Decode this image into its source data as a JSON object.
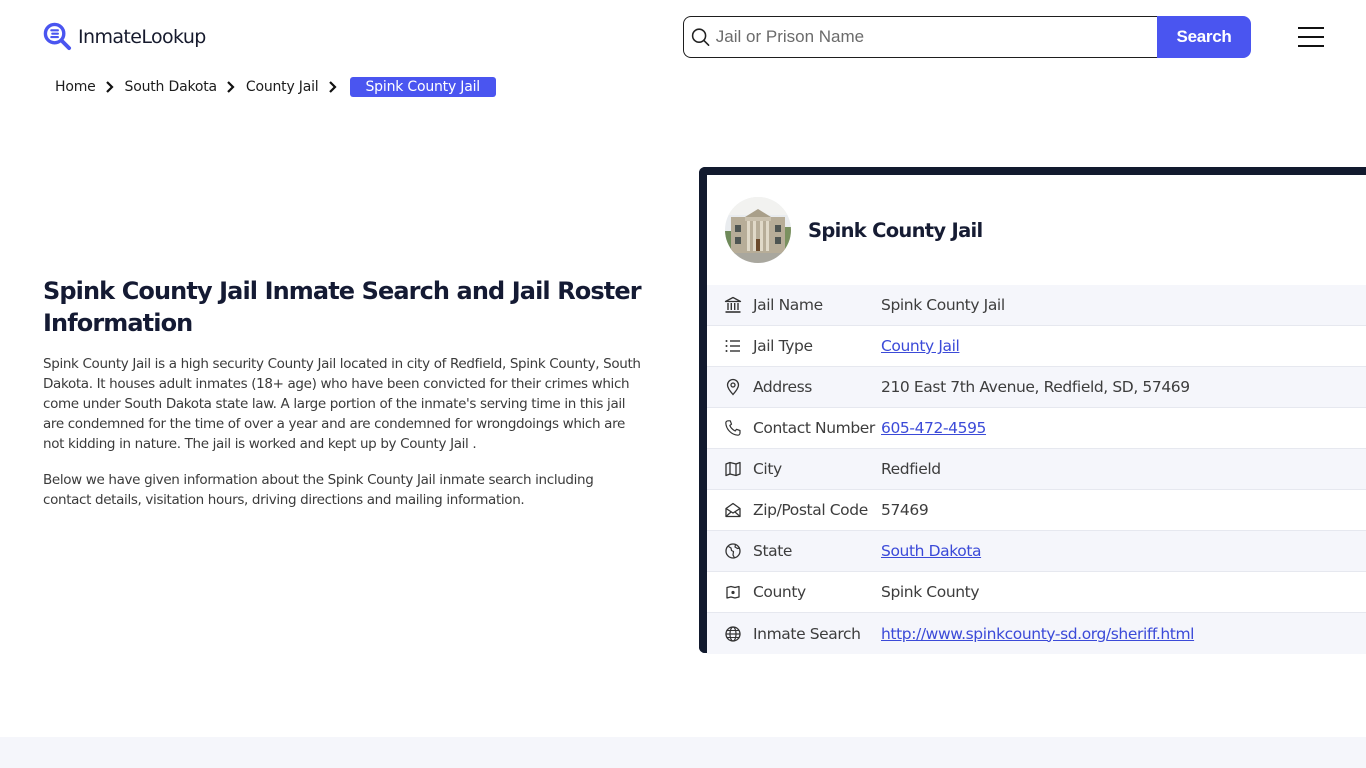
{
  "header": {
    "logo_text": "InmateLookup",
    "search_placeholder": "Jail or Prison Name",
    "search_value": "",
    "search_button": "Search",
    "menu_icon": "hamburger-menu-icon"
  },
  "breadcrumb": {
    "items": [
      "Home",
      "South Dakota",
      "County Jail"
    ],
    "current": "Spink County Jail"
  },
  "main": {
    "title": "Spink County Jail Inmate Search and Jail Roster Information",
    "paragraphs": [
      "Spink County Jail is a high security County Jail located in city of Redfield, Spink County, South Dakota. It houses adult inmates (18+ age) who have been convicted for their crimes which come under South Dakota state law. A large portion of the inmate's serving time in this jail are condemned for the time of over a year and are condemned for wrongdoings which are not kidding in nature. The jail is worked and kept up by County Jail .",
      "Below we have given information about the Spink County Jail inmate search including contact details, visitation hours, driving directions and mailing information."
    ]
  },
  "card": {
    "title": "Spink County Jail",
    "rows": [
      {
        "icon": "bank-building-icon",
        "label": "Jail Name",
        "value": "Spink County Jail",
        "link": false
      },
      {
        "icon": "list-icon",
        "label": "Jail Type",
        "value": "County Jail",
        "link": true
      },
      {
        "icon": "map-pin-icon",
        "label": "Address",
        "value": "210 East 7th Avenue, Redfield, SD, 57469",
        "link": false
      },
      {
        "icon": "phone-icon",
        "label": "Contact Number",
        "value": "605-472-4595",
        "link": true
      },
      {
        "icon": "map-icon",
        "label": "City",
        "value": "Redfield",
        "link": false
      },
      {
        "icon": "mail-open-icon",
        "label": "Zip/Postal Code",
        "value": "57469",
        "link": false
      },
      {
        "icon": "globe-region-icon",
        "label": "State",
        "value": "South Dakota",
        "link": true
      },
      {
        "icon": "county-map-icon",
        "label": "County",
        "value": "Spink County",
        "link": false
      },
      {
        "icon": "world-icon",
        "label": "Inmate Search",
        "value": "http://www.spinkcounty-sd.org/sheriff.html",
        "link": true
      }
    ]
  },
  "colors": {
    "accent": "#4a55f0",
    "card_border": "#121a2e",
    "link": "#3b4ad8",
    "row_alt": "#f5f6fb"
  }
}
